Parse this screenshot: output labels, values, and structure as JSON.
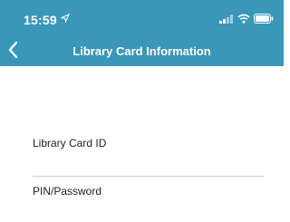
{
  "status": {
    "time": "15:59"
  },
  "nav": {
    "title": "Library Card Information"
  },
  "form": {
    "card_id_label": "Library Card ID",
    "pin_label": "PIN/Password"
  }
}
